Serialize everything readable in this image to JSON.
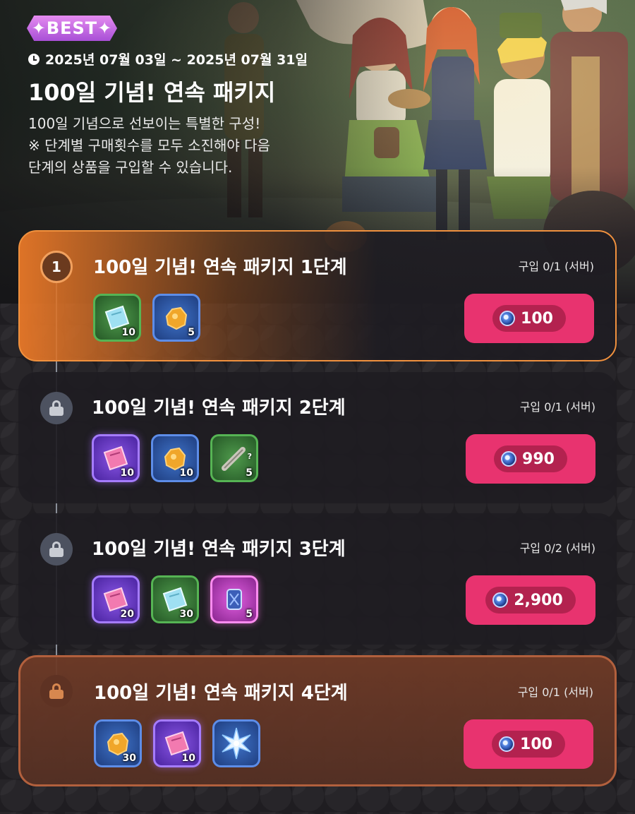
{
  "header": {
    "badge": "✦BEST✦",
    "date_range": "2025년 07월 03일 ~ 2025년 07월 31일",
    "title": "100일 기념! 연속 패키지",
    "desc_line1": "100일 기념으로 선보이는 특별한 구성!",
    "desc_line2": "※ 단계별 구매횟수를 모두 소진해야 다음",
    "desc_line3": "단계의 상품을 구입할 수 있습니다."
  },
  "stages": [
    {
      "step": "1",
      "title": "100일 기념! 연속 패키지 1단계",
      "purchase": "구입 0/1 (서버)",
      "price": "100",
      "items": [
        {
          "icon": "green-ticket-icon",
          "qty": "10"
        },
        {
          "icon": "gold-ore-icon",
          "qty": "5"
        }
      ]
    },
    {
      "step": "",
      "title": "100일 기념! 연속 패키지 2단계",
      "purchase": "구입 0/1 (서버)",
      "price": "990",
      "items": [
        {
          "icon": "purple-ticket-icon",
          "qty": "10"
        },
        {
          "icon": "gold-ore-icon",
          "qty": "10"
        },
        {
          "icon": "mystery-scroll-icon",
          "qty": "5",
          "mark": "?"
        }
      ]
    },
    {
      "step": "",
      "title": "100일 기념! 연속 패키지 3단계",
      "purchase": "구입 0/2 (서버)",
      "price": "2,900",
      "items": [
        {
          "icon": "purple-ticket-icon",
          "qty": "20"
        },
        {
          "icon": "green-ticket-icon",
          "qty": "30"
        },
        {
          "icon": "crystal-scroll-icon",
          "qty": "5"
        }
      ]
    },
    {
      "step": "",
      "title": "100일 기념! 연속 패키지 4단계",
      "purchase": "구입 0/1 (서버)",
      "price": "100",
      "items": [
        {
          "icon": "gold-ore-icon",
          "qty": "30"
        },
        {
          "icon": "purple-ticket-icon",
          "qty": "10"
        },
        {
          "icon": "star-crystal-icon",
          "qty": ""
        }
      ]
    }
  ],
  "colors": {
    "accent_orange": "#f0913e",
    "price_button": "#e8336f",
    "badge_purple": "#c46de6"
  }
}
